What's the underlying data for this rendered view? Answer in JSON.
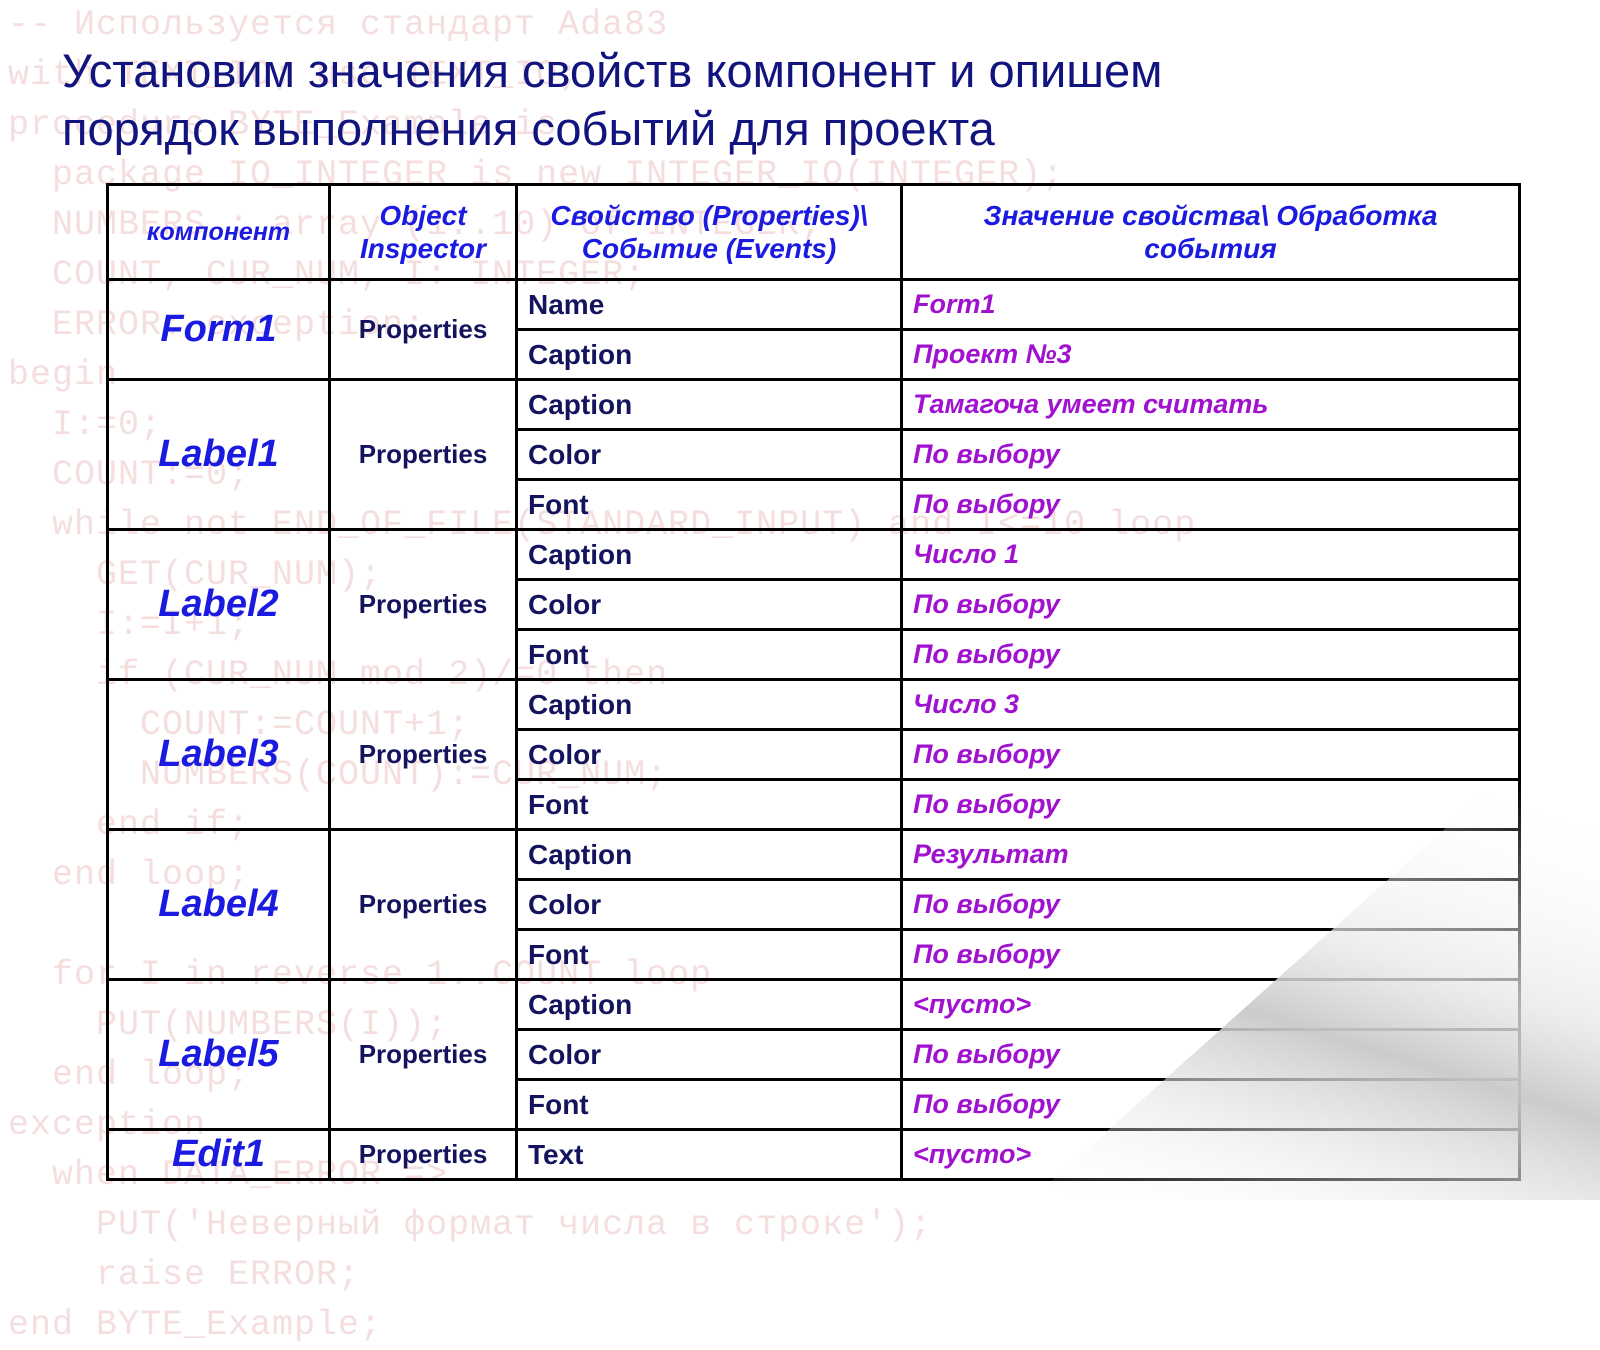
{
  "slide": {
    "title_line1": "Установим  значения  свойств  компонент  и  опишем",
    "title_line2": "порядок выполнения событий для проекта",
    "title_color": "#11137f"
  },
  "colors": {
    "header_blue": "#1a1ae0",
    "component_blue": "#1a1ae0",
    "property_navy": "#14145e",
    "value_purple": "#a012d0",
    "border": "#000000",
    "watermark": "#f4dede"
  },
  "table": {
    "headers": {
      "component": "компонент",
      "object_inspector": "Object Inspector",
      "object_inspector_l1": "Object",
      "object_inspector_l2": "Inspector",
      "property_event_l1": "Свойство (Properties)\\",
      "property_event_l2": "Событие (Events)",
      "value_handler_l1": "Значение свойства\\ Обработка",
      "value_handler_l2": "события"
    },
    "rows": [
      {
        "component": "Form1",
        "inspector": "Properties",
        "props": [
          {
            "name": "Name",
            "value": "Form1"
          },
          {
            "name": "Caption",
            "value": "Проект №3"
          }
        ]
      },
      {
        "component": "Label1",
        "inspector": "Properties",
        "props": [
          {
            "name": "Caption",
            "value": "Тамагоча умеет считать"
          },
          {
            "name": "Color",
            "value": "По выбору"
          },
          {
            "name": "Font",
            "value": "По выбору"
          }
        ]
      },
      {
        "component": "Label2",
        "inspector": "Properties",
        "props": [
          {
            "name": "Caption",
            "value": "Число 1"
          },
          {
            "name": "Color",
            "value": "По выбору"
          },
          {
            "name": "Font",
            "value": "По выбору"
          }
        ]
      },
      {
        "component": "Label3",
        "inspector": "Properties",
        "props": [
          {
            "name": "Caption",
            "value": "Число 3"
          },
          {
            "name": "Color",
            "value": "По выбору"
          },
          {
            "name": "Font",
            "value": "По выбору"
          }
        ]
      },
      {
        "component": "Label4",
        "inspector": "Properties",
        "props": [
          {
            "name": "Caption",
            "value": "Результат"
          },
          {
            "name": "Color",
            "value": "По выбору"
          },
          {
            "name": "Font",
            "value": "По выбору"
          }
        ]
      },
      {
        "component": "Label5",
        "inspector": "Properties",
        "props": [
          {
            "name": "Caption",
            "value": "<пусто>"
          },
          {
            "name": "Color",
            "value": "По выбору"
          },
          {
            "name": "Font",
            "value": "По выбору"
          }
        ]
      },
      {
        "component": "Edit1",
        "inspector": "Properties",
        "props": [
          {
            "name": "Text",
            "value": "<пусто>"
          }
        ]
      }
    ]
  },
  "watermark": {
    "text": "-- Используется стандарт Ada83\nwith TEXT_IO; use TEXT_IO;\nprocedure BYTE_Example is\n  package IO_INTEGER is new INTEGER_IO(INTEGER);\n  NUMBERS : array (1..10) of INTEGER;\n  COUNT, CUR_NUM, I: INTEGER;\n  ERROR: exception;\nbegin\n  I:=0;\n  COUNT:=0;\n  while not END_OF_FILE(STANDARD_INPUT) and I<=10 loop\n    GET(CUR_NUM);\n    I:=I+1;\n    if (CUR_NUM mod 2)/=0 then\n      COUNT:=COUNT+1;\n      NUMBERS(COUNT):=CUR_NUM;\n    end if;\n  end loop;\n\n  for I in reverse 1..COUNT loop\n    PUT(NUMBERS(I));\n  end loop;\nexception\n  when DATA_ERROR =>\n    PUT('Неверный формат числа в строке');\n    raise ERROR;\nend BYTE_Example;"
  }
}
